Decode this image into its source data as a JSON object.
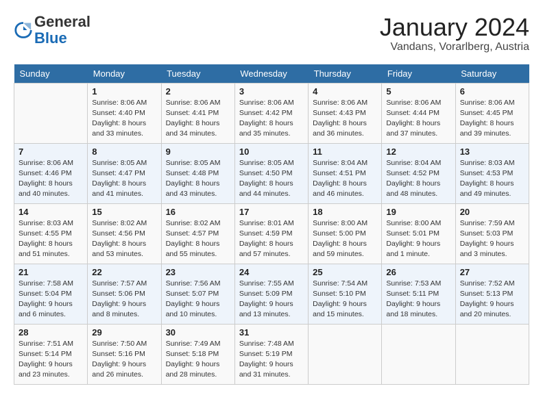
{
  "header": {
    "logo_general": "General",
    "logo_blue": "Blue",
    "month": "January 2024",
    "location": "Vandans, Vorarlberg, Austria"
  },
  "days_of_week": [
    "Sunday",
    "Monday",
    "Tuesday",
    "Wednesday",
    "Thursday",
    "Friday",
    "Saturday"
  ],
  "weeks": [
    [
      {
        "day": "",
        "info": ""
      },
      {
        "day": "1",
        "info": "Sunrise: 8:06 AM\nSunset: 4:40 PM\nDaylight: 8 hours\nand 33 minutes."
      },
      {
        "day": "2",
        "info": "Sunrise: 8:06 AM\nSunset: 4:41 PM\nDaylight: 8 hours\nand 34 minutes."
      },
      {
        "day": "3",
        "info": "Sunrise: 8:06 AM\nSunset: 4:42 PM\nDaylight: 8 hours\nand 35 minutes."
      },
      {
        "day": "4",
        "info": "Sunrise: 8:06 AM\nSunset: 4:43 PM\nDaylight: 8 hours\nand 36 minutes."
      },
      {
        "day": "5",
        "info": "Sunrise: 8:06 AM\nSunset: 4:44 PM\nDaylight: 8 hours\nand 37 minutes."
      },
      {
        "day": "6",
        "info": "Sunrise: 8:06 AM\nSunset: 4:45 PM\nDaylight: 8 hours\nand 39 minutes."
      }
    ],
    [
      {
        "day": "7",
        "info": "Sunrise: 8:06 AM\nSunset: 4:46 PM\nDaylight: 8 hours\nand 40 minutes."
      },
      {
        "day": "8",
        "info": "Sunrise: 8:05 AM\nSunset: 4:47 PM\nDaylight: 8 hours\nand 41 minutes."
      },
      {
        "day": "9",
        "info": "Sunrise: 8:05 AM\nSunset: 4:48 PM\nDaylight: 8 hours\nand 43 minutes."
      },
      {
        "day": "10",
        "info": "Sunrise: 8:05 AM\nSunset: 4:50 PM\nDaylight: 8 hours\nand 44 minutes."
      },
      {
        "day": "11",
        "info": "Sunrise: 8:04 AM\nSunset: 4:51 PM\nDaylight: 8 hours\nand 46 minutes."
      },
      {
        "day": "12",
        "info": "Sunrise: 8:04 AM\nSunset: 4:52 PM\nDaylight: 8 hours\nand 48 minutes."
      },
      {
        "day": "13",
        "info": "Sunrise: 8:03 AM\nSunset: 4:53 PM\nDaylight: 8 hours\nand 49 minutes."
      }
    ],
    [
      {
        "day": "14",
        "info": "Sunrise: 8:03 AM\nSunset: 4:55 PM\nDaylight: 8 hours\nand 51 minutes."
      },
      {
        "day": "15",
        "info": "Sunrise: 8:02 AM\nSunset: 4:56 PM\nDaylight: 8 hours\nand 53 minutes."
      },
      {
        "day": "16",
        "info": "Sunrise: 8:02 AM\nSunset: 4:57 PM\nDaylight: 8 hours\nand 55 minutes."
      },
      {
        "day": "17",
        "info": "Sunrise: 8:01 AM\nSunset: 4:59 PM\nDaylight: 8 hours\nand 57 minutes."
      },
      {
        "day": "18",
        "info": "Sunrise: 8:00 AM\nSunset: 5:00 PM\nDaylight: 8 hours\nand 59 minutes."
      },
      {
        "day": "19",
        "info": "Sunrise: 8:00 AM\nSunset: 5:01 PM\nDaylight: 9 hours\nand 1 minute."
      },
      {
        "day": "20",
        "info": "Sunrise: 7:59 AM\nSunset: 5:03 PM\nDaylight: 9 hours\nand 3 minutes."
      }
    ],
    [
      {
        "day": "21",
        "info": "Sunrise: 7:58 AM\nSunset: 5:04 PM\nDaylight: 9 hours\nand 6 minutes."
      },
      {
        "day": "22",
        "info": "Sunrise: 7:57 AM\nSunset: 5:06 PM\nDaylight: 9 hours\nand 8 minutes."
      },
      {
        "day": "23",
        "info": "Sunrise: 7:56 AM\nSunset: 5:07 PM\nDaylight: 9 hours\nand 10 minutes."
      },
      {
        "day": "24",
        "info": "Sunrise: 7:55 AM\nSunset: 5:09 PM\nDaylight: 9 hours\nand 13 minutes."
      },
      {
        "day": "25",
        "info": "Sunrise: 7:54 AM\nSunset: 5:10 PM\nDaylight: 9 hours\nand 15 minutes."
      },
      {
        "day": "26",
        "info": "Sunrise: 7:53 AM\nSunset: 5:11 PM\nDaylight: 9 hours\nand 18 minutes."
      },
      {
        "day": "27",
        "info": "Sunrise: 7:52 AM\nSunset: 5:13 PM\nDaylight: 9 hours\nand 20 minutes."
      }
    ],
    [
      {
        "day": "28",
        "info": "Sunrise: 7:51 AM\nSunset: 5:14 PM\nDaylight: 9 hours\nand 23 minutes."
      },
      {
        "day": "29",
        "info": "Sunrise: 7:50 AM\nSunset: 5:16 PM\nDaylight: 9 hours\nand 26 minutes."
      },
      {
        "day": "30",
        "info": "Sunrise: 7:49 AM\nSunset: 5:18 PM\nDaylight: 9 hours\nand 28 minutes."
      },
      {
        "day": "31",
        "info": "Sunrise: 7:48 AM\nSunset: 5:19 PM\nDaylight: 9 hours\nand 31 minutes."
      },
      {
        "day": "",
        "info": ""
      },
      {
        "day": "",
        "info": ""
      },
      {
        "day": "",
        "info": ""
      }
    ]
  ]
}
